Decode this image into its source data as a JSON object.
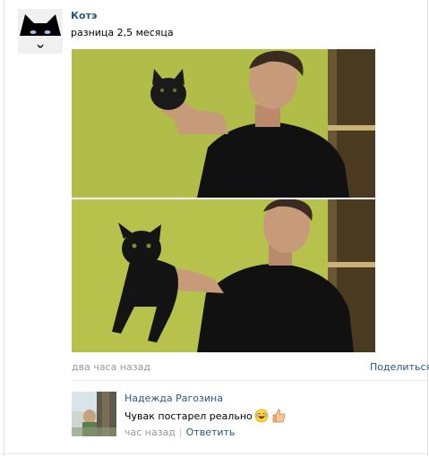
{
  "post": {
    "author": "Котэ",
    "text": "разница 2,5 месяца",
    "time": "два часа назад",
    "share_label": "Поделиться"
  },
  "comment": {
    "author": "Надежда Рагозина",
    "text": "Чувак постарел реально",
    "time": "час назад",
    "separator": "|",
    "reply_label": "Ответить"
  },
  "colors": {
    "link": "#2b587a",
    "meta": "#999999",
    "wall_green": "#b3c04a",
    "sweater": "#111111"
  },
  "icons": [
    "laughing-emoji-icon",
    "thumbs-up-icon"
  ]
}
